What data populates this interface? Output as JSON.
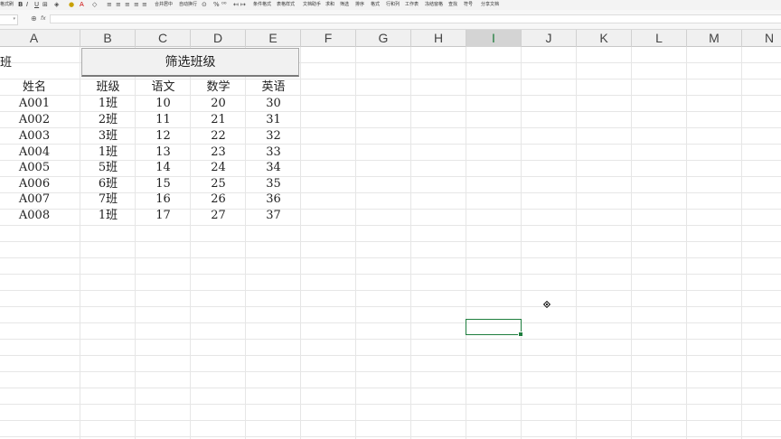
{
  "ribbon": {
    "left_labels": [
      "格式刷",
      "B",
      "I",
      "U"
    ],
    "font_color_glyph": "A",
    "merge_label": "合并居中",
    "wrap_label": "自动换行",
    "percent_label": "%",
    "conditional_format": "条件格式",
    "table_style": "表格样式",
    "doc_assistant": "文档助手",
    "sum_label": "求和",
    "filter_label": "筛选",
    "sort_label": "排序",
    "format_label": "格式",
    "row_col_label": "行和列",
    "worksheet_label": "工作表",
    "freeze_label": "冻结窗格",
    "find_label": "查找",
    "symbol_label": "符号",
    "share_label": "分享文档"
  },
  "formula_bar": {
    "fx": "fx",
    "value": ""
  },
  "columns": [
    "A",
    "B",
    "C",
    "D",
    "E",
    "F",
    "G",
    "H",
    "I",
    "J",
    "K",
    "L",
    "M",
    "N"
  ],
  "selected_column": "I",
  "cell_a1": "班",
  "filter_button_label": "筛选班级",
  "table": {
    "headers": [
      "姓名",
      "班级",
      "语文",
      "数学",
      "英语"
    ],
    "rows": [
      [
        "A001",
        "1班",
        "10",
        "20",
        "30"
      ],
      [
        "A002",
        "2班",
        "11",
        "21",
        "31"
      ],
      [
        "A003",
        "3班",
        "12",
        "22",
        "32"
      ],
      [
        "A004",
        "1班",
        "13",
        "23",
        "33"
      ],
      [
        "A005",
        "5班",
        "14",
        "24",
        "34"
      ],
      [
        "A006",
        "6班",
        "15",
        "25",
        "35"
      ],
      [
        "A007",
        "7班",
        "16",
        "26",
        "36"
      ],
      [
        "A008",
        "1班",
        "17",
        "27",
        "37"
      ]
    ]
  },
  "colors": {
    "selection_green": "#1e7e3e",
    "header_bg": "#f0f0f0",
    "grid_line": "#e6e6e6"
  }
}
